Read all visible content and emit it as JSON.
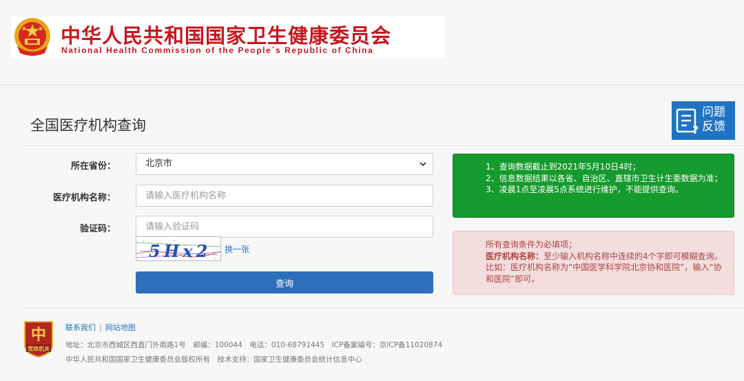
{
  "header": {
    "title_cn": "中华人民共和国国家卫生健康委员会",
    "title_en": "National Health Commission of the People´s Republic of China"
  },
  "page": {
    "title": "全国医疗机构查询",
    "feedback_line1": "问题",
    "feedback_line2": "反馈"
  },
  "form": {
    "province_label": "所在省份：",
    "province_value": "北京市",
    "province_options": [
      "北京市"
    ],
    "org_name_label": "医疗机构名称：",
    "org_name_placeholder": "请输入医疗机构名称",
    "captcha_label": "验证码：",
    "captcha_placeholder": "请输入验证码",
    "captcha_text": "5Hx2",
    "refresh_label": "换一张",
    "submit_label": "查询"
  },
  "notice_info": {
    "line1": "1、查询数据截止到2021年5月10日4时；",
    "line2": "2、信息数据结果以各省、自治区、直辖市卫生计生委数据为准；",
    "line3": "3、凌晨1点至凌晨5点系统进行维护，不能提供查询。"
  },
  "notice_warning": {
    "line1": "所有查询条件为必填项；",
    "bold_label": "医疗机构名称：",
    "line2": "至少输入机构名称中连续的4个字即可模糊查询。比如：医疗机构名称为“中国医学科学院北京协和医院”，输入“协和医院”即可。"
  },
  "footer": {
    "logo_text": "党政机关",
    "contact_link": "联系我们",
    "sitemap_link": "网站地图",
    "link_separator": "|",
    "address": "地址：北京市西城区西直门外南路1号　邮编：100044　电话：010-68791445　ICP备案编号：京ICP备11020874",
    "copyright": "中华人民共和国国家卫生健康委员会版权所有　技术支持：国家卫生健康委员会统计信息中心"
  },
  "colors": {
    "brand_red": "#c8161d",
    "primary_blue": "#2d6fba",
    "notice_green": "#159a2d",
    "notice_red_bg": "#f3dddd",
    "notice_red_text": "#a94442"
  }
}
